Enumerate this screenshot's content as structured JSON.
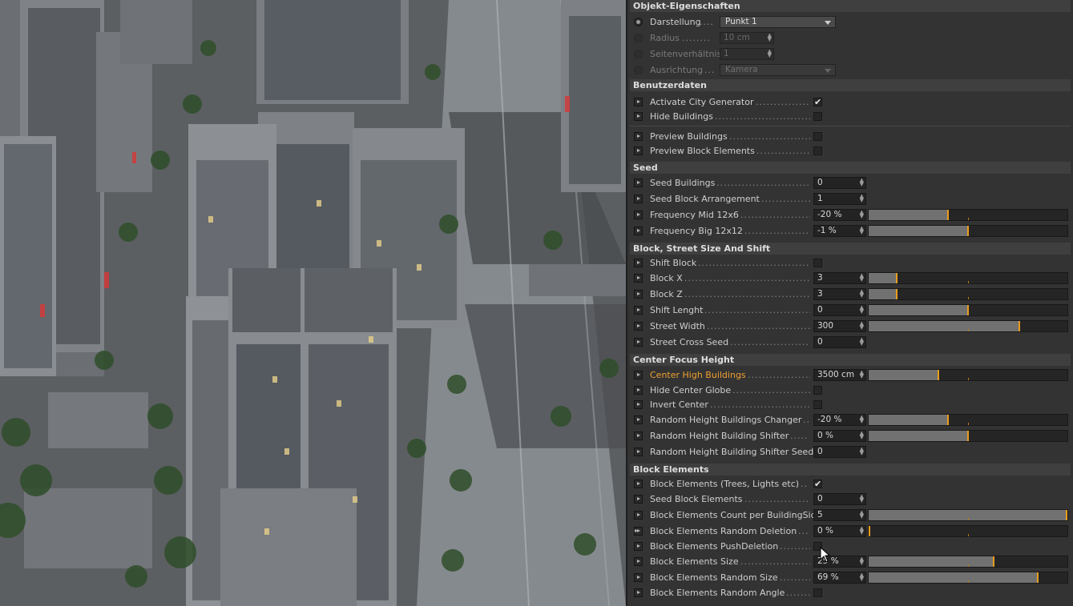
{
  "panel": {
    "object_props_title": "Objekt-Eigenschaften",
    "darstellung": {
      "label": "Darstellung",
      "value": "Punkt 1"
    },
    "radius": {
      "label": "Radius",
      "value": "10 cm"
    },
    "seitenverhaeltnis": {
      "label": "Seitenverhältnis",
      "value": "1"
    },
    "ausrichtung": {
      "label": "Ausrichtung",
      "value": "Kamera"
    },
    "sections": {
      "benutzerdaten": "Benutzerdaten",
      "seed": "Seed",
      "block_street": "Block, Street Size And Shift",
      "center_focus": "Center Focus Height",
      "block_elements": "Block Elements"
    },
    "rows": {
      "activate_city": {
        "label": "Activate City Generator",
        "checked": true
      },
      "hide_buildings": {
        "label": "Hide Buildings",
        "checked": false
      },
      "preview_buildings": {
        "label": "Preview Buildings",
        "checked": false
      },
      "preview_block": {
        "label": "Preview Block Elements",
        "checked": false
      },
      "seed_buildings": {
        "label": "Seed Buildings",
        "value": "0"
      },
      "seed_block_arr": {
        "label": "Seed Block Arrangement",
        "value": "1"
      },
      "freq_mid": {
        "label": "Frequency Mid 12x6",
        "value": "-20 %",
        "level": 0.4
      },
      "freq_big": {
        "label": "Frequency Big 12x12",
        "value": "-1 %",
        "level": 0.5
      },
      "shift_block": {
        "label": "Shift Block",
        "checked": false
      },
      "block_x": {
        "label": "Block X",
        "value": "3",
        "level": 0.14
      },
      "block_z": {
        "label": "Block Z",
        "value": "3",
        "level": 0.14
      },
      "shift_lenght": {
        "label": "Shift Lenght",
        "value": "0",
        "level": 0.5
      },
      "street_width": {
        "label": "Street Width",
        "value": "300",
        "level": 0.76
      },
      "street_cross_seed": {
        "label": "Street Cross Seed",
        "value": "0"
      },
      "center_high": {
        "label": "Center High Buildings",
        "value": "3500 cm",
        "level": 0.35
      },
      "hide_center_globe": {
        "label": "Hide Center Globe",
        "checked": false
      },
      "invert_center": {
        "label": "Invert Center",
        "checked": false
      },
      "rand_height_changer": {
        "label": "Random Height Buildings Changer",
        "value": "-20 %",
        "level": 0.4
      },
      "rand_height_shifter": {
        "label": "Random Height Building Shifter",
        "value": "0 %",
        "level": 0.5
      },
      "rand_height_shifter_seed": {
        "label": "Random Height Building Shifter Seed",
        "value": "0"
      },
      "block_elements_trees": {
        "label": "Block Elements (Trees, Lights etc)",
        "checked": true
      },
      "seed_block_elements": {
        "label": "Seed Block Elements",
        "value": "0"
      },
      "block_count": {
        "label": "Block Elements Count per BuildingSide",
        "value": "5",
        "level": 1.0
      },
      "block_random_deletion": {
        "label": "Block Elements Random Deletion",
        "value": "0 %",
        "level": 0.0
      },
      "block_push_deletion": {
        "label": "Block Elements PushDeletion",
        "checked": false
      },
      "block_size": {
        "label": "Block Elements Size",
        "value": "25 %",
        "level": 0.63
      },
      "block_random_size": {
        "label": "Block Elements Random Size",
        "value": "69 %",
        "level": 0.85
      },
      "block_random_angle": {
        "label": "Block Elements Random Angle",
        "checked": false
      }
    }
  },
  "colors": {
    "accent": "#e99b1c",
    "highlight_label": "#f0a030",
    "panel_bg": "#333333"
  }
}
